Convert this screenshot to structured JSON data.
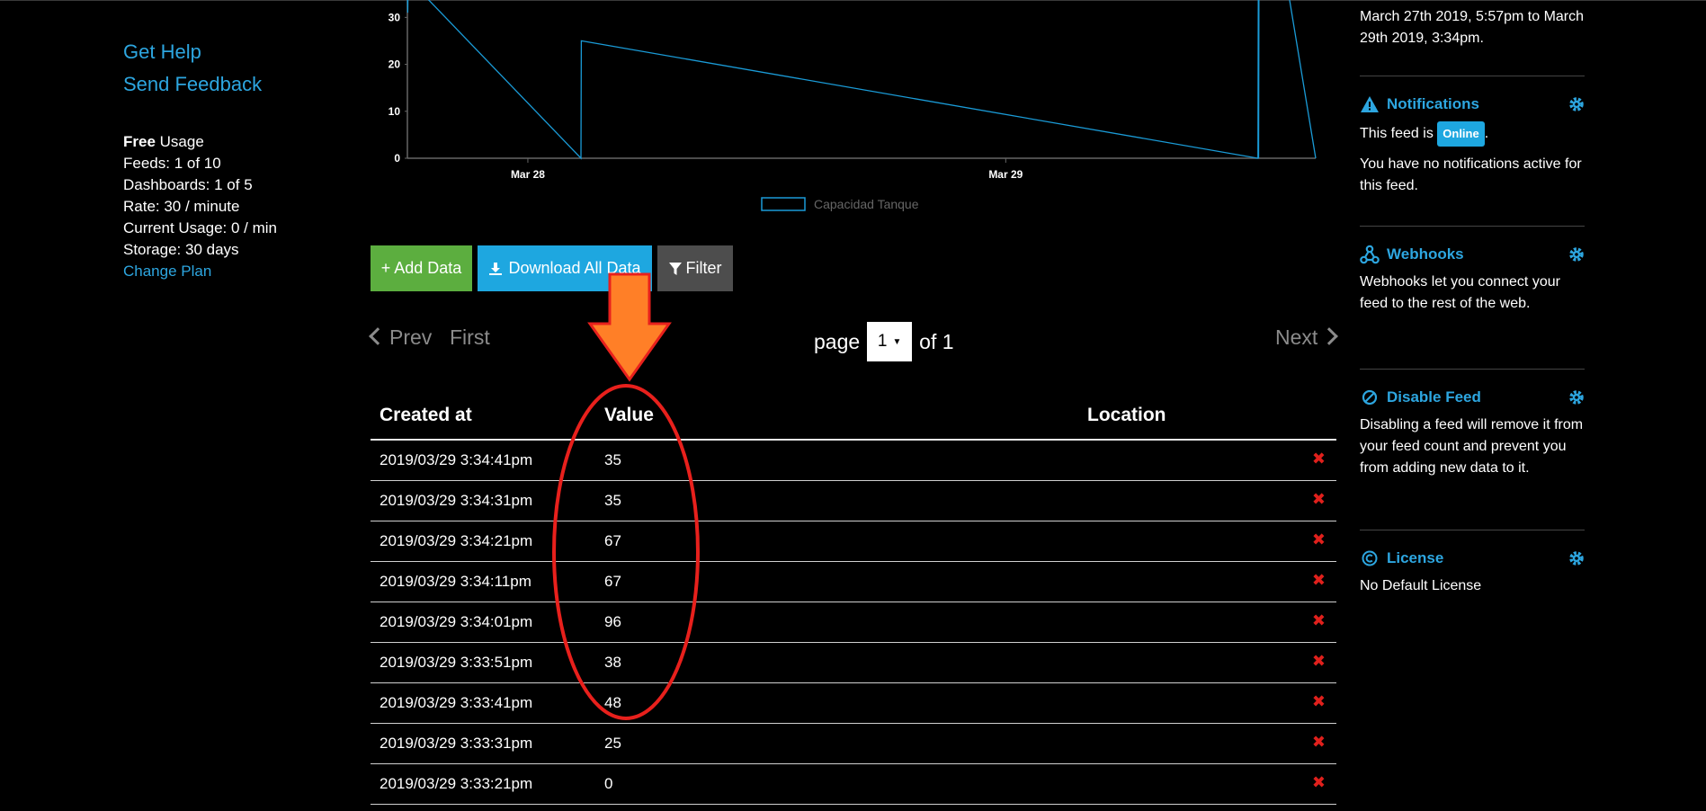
{
  "left_sidebar": {
    "get_help": "Get Help",
    "send_feedback": "Send Feedback",
    "plan_name": "Free",
    "usage_label": "Usage",
    "feeds": "Feeds: 1 of 10",
    "dashboards": "Dashboards: 1 of 5",
    "rate": "Rate: 30 / minute",
    "current_usage": "Current Usage: 0 / min",
    "storage": "Storage: 30 days",
    "change_plan": "Change Plan"
  },
  "chart_data": {
    "type": "line",
    "x_tick_labels": [
      "Mar 28",
      "Mar 29"
    ],
    "y_tick_labels": [
      "0",
      "10",
      "20",
      "30"
    ],
    "ylim": [
      0,
      36
    ],
    "legend": "Capacidad Tanque",
    "legend_position": "bottom-center",
    "line_color": "#1a9bd7",
    "series": [
      {
        "name": "Capacidad Tanque",
        "points": [
          {
            "x": "2019-03-27 17:57",
            "y": 36
          },
          {
            "x": "2019-03-27 17:58",
            "y": 31
          },
          {
            "x": "2019-03-27 17:59",
            "y": 36
          },
          {
            "x": "2019-03-27 18:30",
            "y": 36
          },
          {
            "x": "2019-03-28 02:40",
            "y": 0
          },
          {
            "x": "2019-03-28 02:41",
            "y": 25
          },
          {
            "x": "2019-03-29 12:40",
            "y": 0
          },
          {
            "x": "2019-03-29 12:41",
            "y": 36
          },
          {
            "x": "2019-03-29 12:42",
            "y": 0
          },
          {
            "x": "2019-03-29 12:43",
            "y": 36
          },
          {
            "x": "2019-03-29 14:10",
            "y": 36
          },
          {
            "x": "2019-03-29 15:34",
            "y": 0
          }
        ]
      }
    ]
  },
  "buttons": {
    "add_data": "+ Add Data",
    "download_all": "Download All Data",
    "filter": "Filter"
  },
  "pagination": {
    "prev": "Prev",
    "first": "First",
    "next": "Next",
    "page_label": "page",
    "page_value": "1",
    "of_label": "of 1"
  },
  "table": {
    "headers": [
      "Created at",
      "Value",
      "Location"
    ],
    "rows": [
      {
        "created": "2019/03/29 3:34:41pm",
        "value": "35"
      },
      {
        "created": "2019/03/29 3:34:31pm",
        "value": "35"
      },
      {
        "created": "2019/03/29 3:34:21pm",
        "value": "67"
      },
      {
        "created": "2019/03/29 3:34:11pm",
        "value": "67"
      },
      {
        "created": "2019/03/29 3:34:01pm",
        "value": "96"
      },
      {
        "created": "2019/03/29 3:33:51pm",
        "value": "38"
      },
      {
        "created": "2019/03/29 3:33:41pm",
        "value": "48"
      },
      {
        "created": "2019/03/29 3:33:31pm",
        "value": "25"
      },
      {
        "created": "2019/03/29 3:33:21pm",
        "value": "0"
      }
    ],
    "delete_icon": "✖"
  },
  "right_sidebar": {
    "intro": "March 27th 2019, 5:57pm to March 29th 2019, 3:34pm.",
    "notifications": {
      "title": "Notifications",
      "text_before": "This feed is",
      "status": "Online",
      "text_after": ".",
      "text2": "You have no notifications active for this feed."
    },
    "webhooks": {
      "title": "Webhooks",
      "text": "Webhooks let you connect your feed to the rest of the web."
    },
    "disable_feed": {
      "title": "Disable Feed",
      "text": "Disabling a feed will remove it from your feed count and prevent you from adding new data to it."
    },
    "license": {
      "title": "License",
      "text": "No Default License"
    }
  },
  "colors": {
    "accent": "#2da6e0",
    "add_button": "#5cae3f",
    "download_button": "#1ea7e0",
    "filter_button": "#4d4d4d",
    "delete": "#e0201c",
    "annotation_arrow": "#ff7f27",
    "annotation_circle": "#e8201c"
  }
}
